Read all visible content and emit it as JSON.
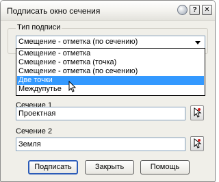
{
  "window": {
    "title": "Подписать окно сечения",
    "help_label": "?",
    "close_label": "✕"
  },
  "label_type": {
    "legend": "Тип подписи",
    "selected": "Смещение - отметка (по сечению)",
    "options": [
      "Смещение - отметка",
      "Смещение - отметка (точка)",
      "Смещение - отметка (по сечению)",
      "Две точки",
      "Междупутье"
    ],
    "highlighted": "Две точки"
  },
  "section1": {
    "label": "Сечение 1",
    "value": "Проектная"
  },
  "section2": {
    "label": "Сечение 2",
    "value": "Земля"
  },
  "buttons": {
    "sign": "Подписать",
    "close": "Закрыть",
    "help": "Помощь"
  }
}
